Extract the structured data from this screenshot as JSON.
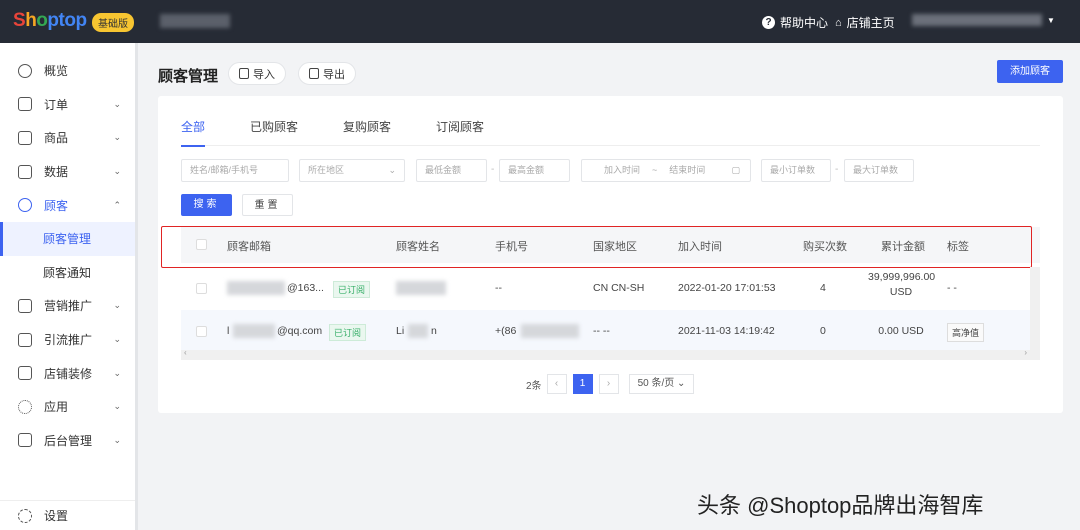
{
  "header": {
    "logo": "Shoptop",
    "plan_badge": "基础版",
    "help": "帮助中心",
    "store_home": "店铺主页"
  },
  "sidebar": {
    "items": [
      {
        "label": "概览"
      },
      {
        "label": "订单"
      },
      {
        "label": "商品"
      },
      {
        "label": "数据"
      },
      {
        "label": "顾客"
      },
      {
        "label": "顾客管理"
      },
      {
        "label": "顾客通知"
      },
      {
        "label": "营销推广"
      },
      {
        "label": "引流推广"
      },
      {
        "label": "店铺装修"
      },
      {
        "label": "应用"
      },
      {
        "label": "后台管理"
      }
    ],
    "settings": "设置"
  },
  "page": {
    "title": "顾客管理",
    "import": "导入",
    "export": "导出",
    "add_customer": "添加顾客"
  },
  "tabs": [
    "全部",
    "已购顾客",
    "复购顾客",
    "订阅顾客"
  ],
  "filters": {
    "keyword_placeholder": "姓名/邮箱/手机号",
    "region_placeholder": "所在地区",
    "min_amount": "最低金额",
    "max_amount": "最高金额",
    "start_time": "加入时间",
    "end_time": "结束时间",
    "min_orders": "最小订单数",
    "max_orders": "最大订单数",
    "search": "搜索",
    "reset": "重置"
  },
  "table": {
    "headers": [
      "顾客邮箱",
      "顾客姓名",
      "手机号",
      "国家地区",
      "加入时间",
      "购买次数",
      "累计金额",
      "标签"
    ],
    "rows": [
      {
        "email": "@163...",
        "subscribed": "已订阅",
        "name": "",
        "phone": "--",
        "region": "CN CN-SH",
        "joined": "2022-01-20 17:01:53",
        "orders": "4",
        "amount": "39,999,996.00",
        "currency": "USD",
        "tags": "- -"
      },
      {
        "email": "@qq.com",
        "email_prefix": "l",
        "subscribed": "已订阅",
        "name": "Li",
        "name_suffix": "n",
        "phone": "+(86",
        "region": "-- --",
        "joined": "2021-11-03 14:19:42",
        "orders": "0",
        "amount": "0.00 USD",
        "currency": "",
        "tags": "高净值"
      }
    ]
  },
  "pagination": {
    "total": "2条",
    "current": "1",
    "page_size": "50 条/页"
  },
  "watermark": "头条 @Shoptop品牌出海智库"
}
